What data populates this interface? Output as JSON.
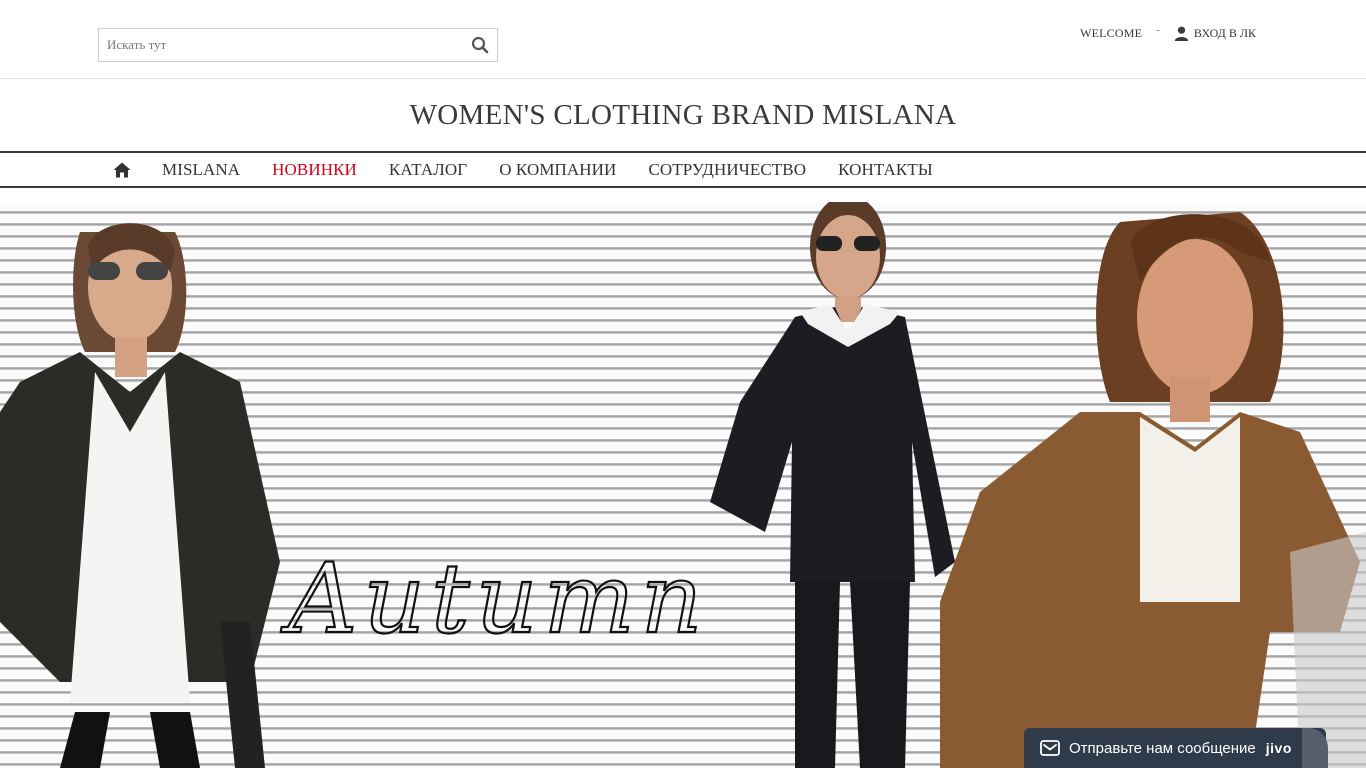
{
  "stray_mark": "\"",
  "search": {
    "placeholder": "Искать тут"
  },
  "topnav": {
    "welcome": "WELCOME",
    "separator": "-",
    "login_label": "ВХОД В ЛК"
  },
  "brand": {
    "title": "WOMEN'S CLOTHING BRAND MISLANA"
  },
  "menu": {
    "items": [
      {
        "label": "MISLANA"
      },
      {
        "label": "НОВИНКИ"
      },
      {
        "label": "КАТАЛОГ"
      },
      {
        "label": "О КОМПАНИИ"
      },
      {
        "label": "СОТРУДНИЧЕСТВО"
      },
      {
        "label": "КОНТАКТЫ"
      }
    ],
    "active_color": "#d0021b"
  },
  "hero": {
    "caption": "Autumn"
  },
  "chat": {
    "text": "Отправьте нам сообщение",
    "brand": "jivo",
    "background": "#2f3a4a"
  },
  "icons": {
    "search": "search-icon",
    "user": "user-icon",
    "home": "home-icon",
    "mail": "mail-icon"
  }
}
